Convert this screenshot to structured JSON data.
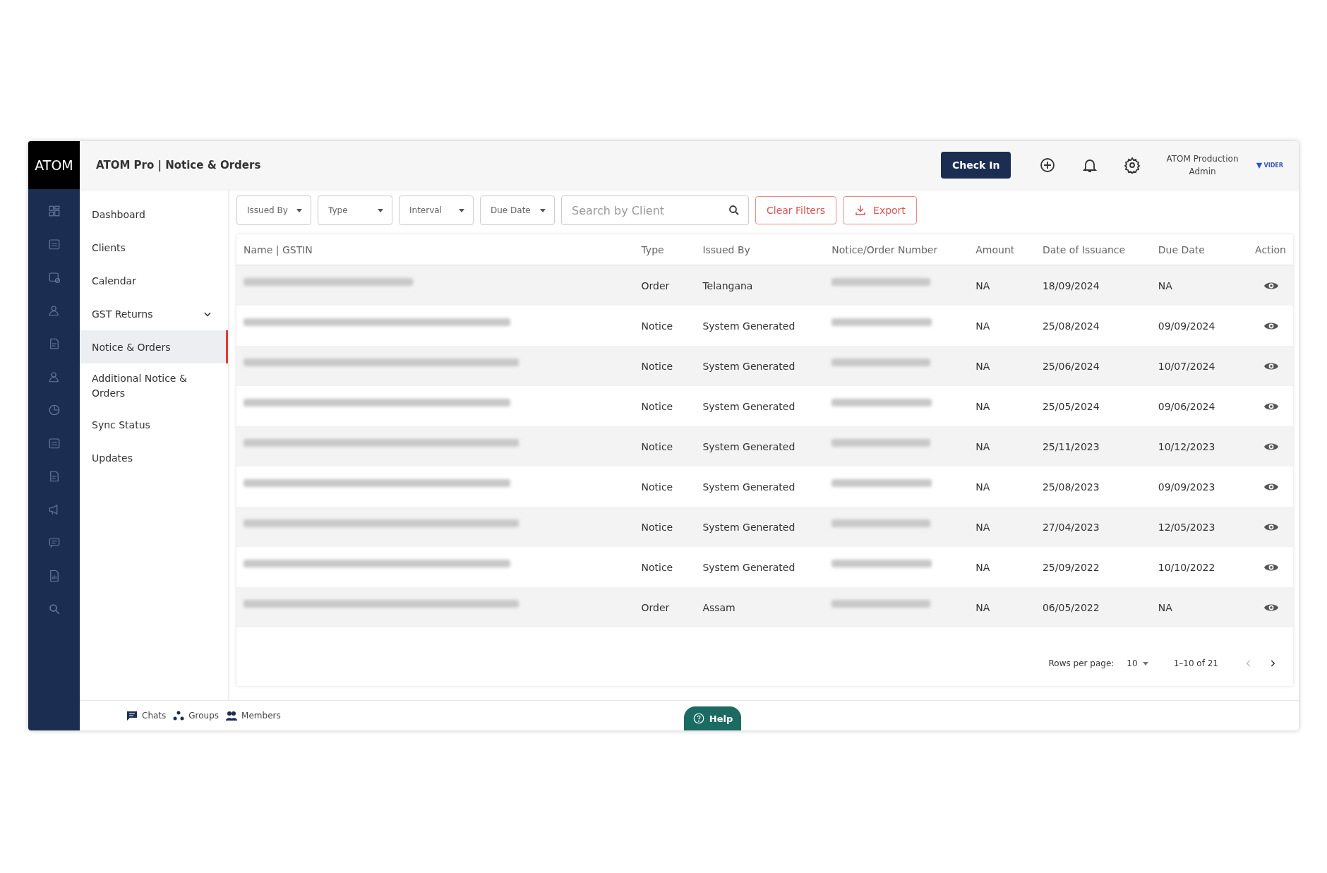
{
  "app": {
    "logo": "ATOM",
    "title": "ATOM Pro | Notice & Orders"
  },
  "header": {
    "check_in": "Check In",
    "user_name": "ATOM Production",
    "user_role": "Admin",
    "brand": "VIDER"
  },
  "sidebar": {
    "items": [
      {
        "label": "Dashboard",
        "selected": false,
        "expandable": false
      },
      {
        "label": "Clients",
        "selected": false,
        "expandable": false
      },
      {
        "label": "Calendar",
        "selected": false,
        "expandable": false
      },
      {
        "label": "GST Returns",
        "selected": false,
        "expandable": true
      },
      {
        "label": "Notice & Orders",
        "selected": true,
        "expandable": false
      },
      {
        "label": "Additional Notice & Orders",
        "selected": false,
        "expandable": false
      },
      {
        "label": "Sync Status",
        "selected": false,
        "expandable": false
      },
      {
        "label": "Updates",
        "selected": false,
        "expandable": false
      }
    ]
  },
  "filters": {
    "dropdowns": [
      "Issued By",
      "Type",
      "Interval",
      "Due Date"
    ],
    "search": {
      "placeholder": "Search by Client"
    },
    "clear": "Clear Filters",
    "export": "Export"
  },
  "table": {
    "columns": [
      "Name | GSTIN",
      "Type",
      "Issued By",
      "Notice/Order Number",
      "Amount",
      "Date of Issuance",
      "Due Date",
      "Action"
    ],
    "rows": [
      {
        "type": "Order",
        "issued_by": "Telangana",
        "amount": "NA",
        "issued": "18/09/2024",
        "due": "NA"
      },
      {
        "type": "Notice",
        "issued_by": "System Generated",
        "amount": "NA",
        "issued": "25/08/2024",
        "due": "09/09/2024"
      },
      {
        "type": "Notice",
        "issued_by": "System Generated",
        "amount": "NA",
        "issued": "25/06/2024",
        "due": "10/07/2024"
      },
      {
        "type": "Notice",
        "issued_by": "System Generated",
        "amount": "NA",
        "issued": "25/05/2024",
        "due": "09/06/2024"
      },
      {
        "type": "Notice",
        "issued_by": "System Generated",
        "amount": "NA",
        "issued": "25/11/2023",
        "due": "10/12/2023"
      },
      {
        "type": "Notice",
        "issued_by": "System Generated",
        "amount": "NA",
        "issued": "25/08/2023",
        "due": "09/09/2023"
      },
      {
        "type": "Notice",
        "issued_by": "System Generated",
        "amount": "NA",
        "issued": "27/04/2023",
        "due": "12/05/2023"
      },
      {
        "type": "Notice",
        "issued_by": "System Generated",
        "amount": "NA",
        "issued": "25/09/2022",
        "due": "10/10/2022"
      },
      {
        "type": "Order",
        "issued_by": "Assam",
        "amount": "NA",
        "issued": "06/05/2022",
        "due": "NA"
      }
    ]
  },
  "pagination": {
    "label": "Rows per page:",
    "rows_per_page": "10",
    "range": "1–10 of 21",
    "prev_disabled": true,
    "next_disabled": false
  },
  "footer": {
    "links": [
      "Chats",
      "Groups",
      "Members"
    ],
    "help": "Help"
  }
}
